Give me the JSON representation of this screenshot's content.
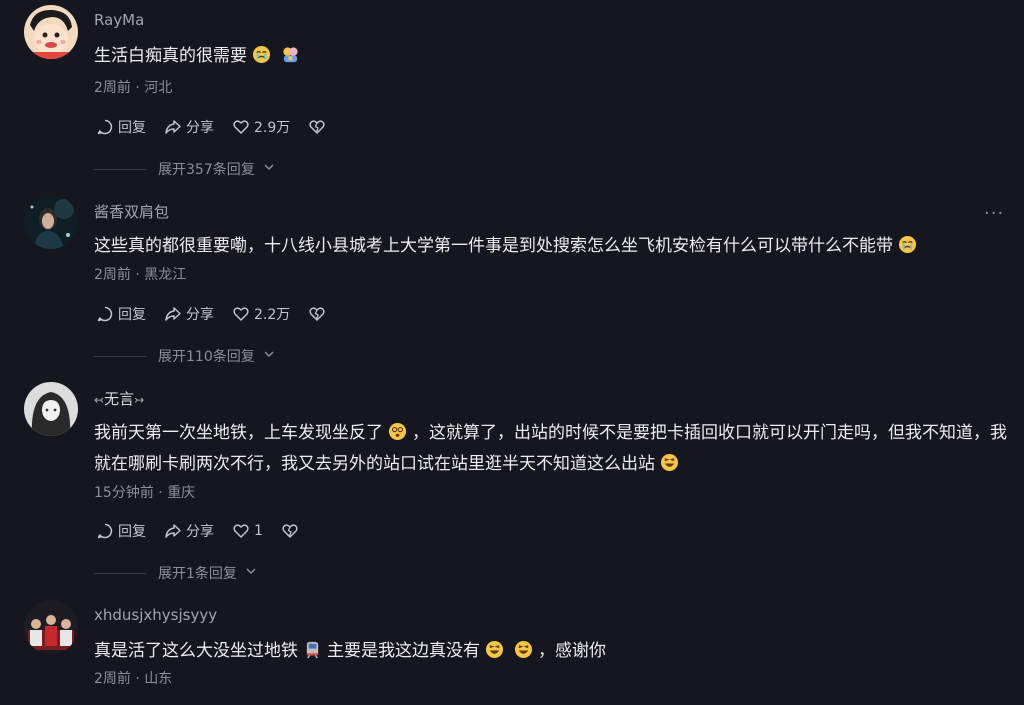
{
  "comments": [
    {
      "username": "RayMa",
      "text": "生活白痴真的很需要",
      "time": "2周前",
      "location": "河北",
      "sep": "·",
      "reply_label": "回复",
      "share_label": "分享",
      "likes": "2.9万",
      "expand_label": "展开357条回复"
    },
    {
      "username": "酱香双肩包",
      "text": "这些真的都很重要嘞，十八线小县城考上大学第一件事是到处搜索怎么坐飞机安检有什么可以带什么不能带",
      "time": "2周前",
      "location": "黑龙江",
      "sep": "·",
      "reply_label": "回复",
      "share_label": "分享",
      "likes": "2.2万",
      "expand_label": "展开110条回复",
      "more_label": "···"
    },
    {
      "username": "无言",
      "text_a": "我前天第一次坐地铁，上车发现坐反了",
      "text_b": "，这就算了，出站的时候不是要把卡插回收口就可以开门走吗，但我不知道，我就在哪刷卡刷两次不行，我又去另外的站口试在站里逛半天不知道这么出站",
      "time": "15分钟前",
      "location": "重庆",
      "sep": "·",
      "reply_label": "回复",
      "share_label": "分享",
      "likes": "1",
      "expand_label": "展开1条回复"
    },
    {
      "username": "xhdusjxhysjsyyy",
      "text_a": "真是活了这么大没坐过地铁",
      "text_b": "主要是我这边真没有",
      "text_c": "，感谢你",
      "time": "2周前",
      "location": "山东",
      "sep": "·"
    }
  ],
  "icons": {
    "reply": "speech-bubble-icon",
    "share": "share-arrow-icon",
    "like": "heart-icon",
    "dislike": "broken-heart-icon",
    "expand": "chevron-down-icon"
  },
  "colors": {
    "background": "#16161e",
    "text": "#ececf0",
    "muted": "#8e8e97"
  }
}
